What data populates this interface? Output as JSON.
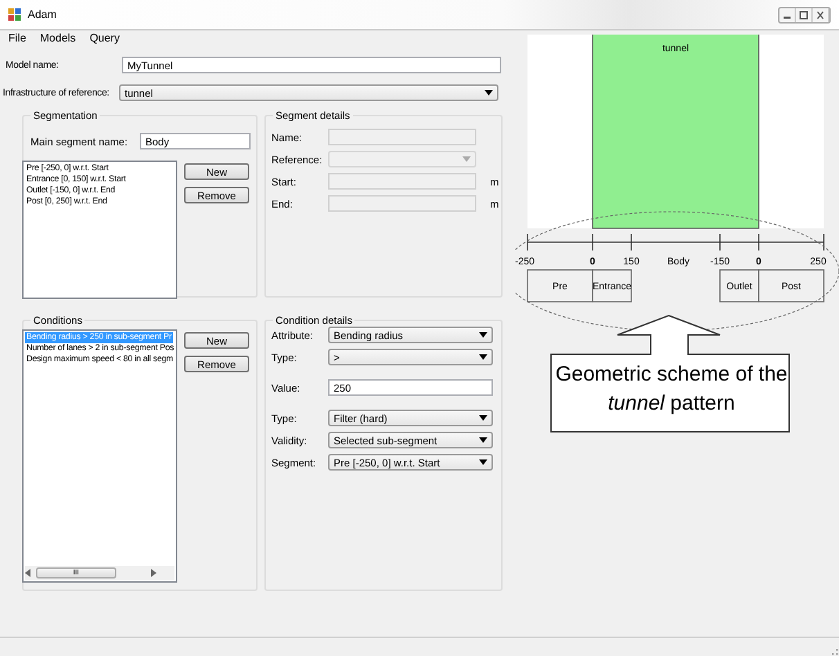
{
  "window": {
    "title": "Adam"
  },
  "menu": [
    {
      "label": "File"
    },
    {
      "label": "Models"
    },
    {
      "label": "Query"
    }
  ],
  "model_name": {
    "label": "Model name:",
    "kind": "text",
    "value": "MyTunnel"
  },
  "infrastructure": {
    "label": "Infrastructure of reference:",
    "kind": "dropdown",
    "value": "tunnel"
  },
  "segmentation": {
    "title": "Segmentation",
    "main_label": "Main segment name:",
    "main_value": "Body",
    "items": [
      {
        "text": "Pre [-250, 0] w.r.t. Start",
        "selected": false
      },
      {
        "text": "Entrance [0, 150] w.r.t. Start",
        "selected": false
      },
      {
        "text": "Outlet [-150, 0] w.r.t. End",
        "selected": false
      },
      {
        "text": "Post [0, 250] w.r.t. End",
        "selected": false
      }
    ],
    "buttons": [
      "New",
      "Remove"
    ]
  },
  "segment_details": {
    "title": "Segment details",
    "fields": [
      {
        "label": "Name:",
        "kind": "text",
        "disabled": true
      },
      {
        "label": "Reference:",
        "kind": "dropdown",
        "disabled": true
      },
      {
        "label": "Start:",
        "kind": "text",
        "disabled": true,
        "unit": "m"
      },
      {
        "label": "End:",
        "kind": "text",
        "disabled": true,
        "unit": "m"
      }
    ]
  },
  "conditions": {
    "title": "Conditions",
    "items": [
      {
        "text": "Bending radius > 250 in sub-segment Pr",
        "selected": true
      },
      {
        "text": "Number of lanes > 2 in sub-segment Pos",
        "selected": false
      },
      {
        "text": "Design maximum speed < 80 in all segm",
        "selected": false
      }
    ],
    "scroll_mark": "III",
    "buttons": [
      "New",
      "Remove"
    ]
  },
  "condition_details": {
    "title": "Condition details",
    "fields": [
      {
        "label": "Attribute:",
        "kind": "dropdown",
        "value": "Bending radius",
        "disabled": false
      },
      {
        "label": "Type:",
        "kind": "dropdown",
        "value": ">",
        "disabled": false
      },
      {
        "label": "Value:",
        "kind": "text",
        "value": "250",
        "disabled": false
      },
      {
        "label": "Type:",
        "kind": "dropdown",
        "value": "Filter (hard)",
        "disabled": false
      },
      {
        "label": "Validity:",
        "kind": "dropdown",
        "value": "Selected sub-segment",
        "disabled": false
      },
      {
        "label": "Segment:",
        "kind": "dropdown",
        "value": "Pre [-250, 0] w.r.t. Start",
        "disabled": false
      }
    ]
  },
  "diagram": {
    "block_label": "tunnel",
    "ticks": [
      {
        "label": "-250",
        "origin": false
      },
      {
        "label": "0",
        "origin": true
      },
      {
        "label": "150",
        "origin": false
      },
      {
        "label": "-150",
        "origin": false
      },
      {
        "label": "0",
        "origin": true
      },
      {
        "label": "250",
        "origin": false
      }
    ],
    "middle_label": "Body",
    "segments": [
      "Pre",
      "Entrance",
      "Outlet",
      "Post"
    ]
  },
  "callout": {
    "text": "Geometric scheme of the *tunnel* pattern"
  }
}
